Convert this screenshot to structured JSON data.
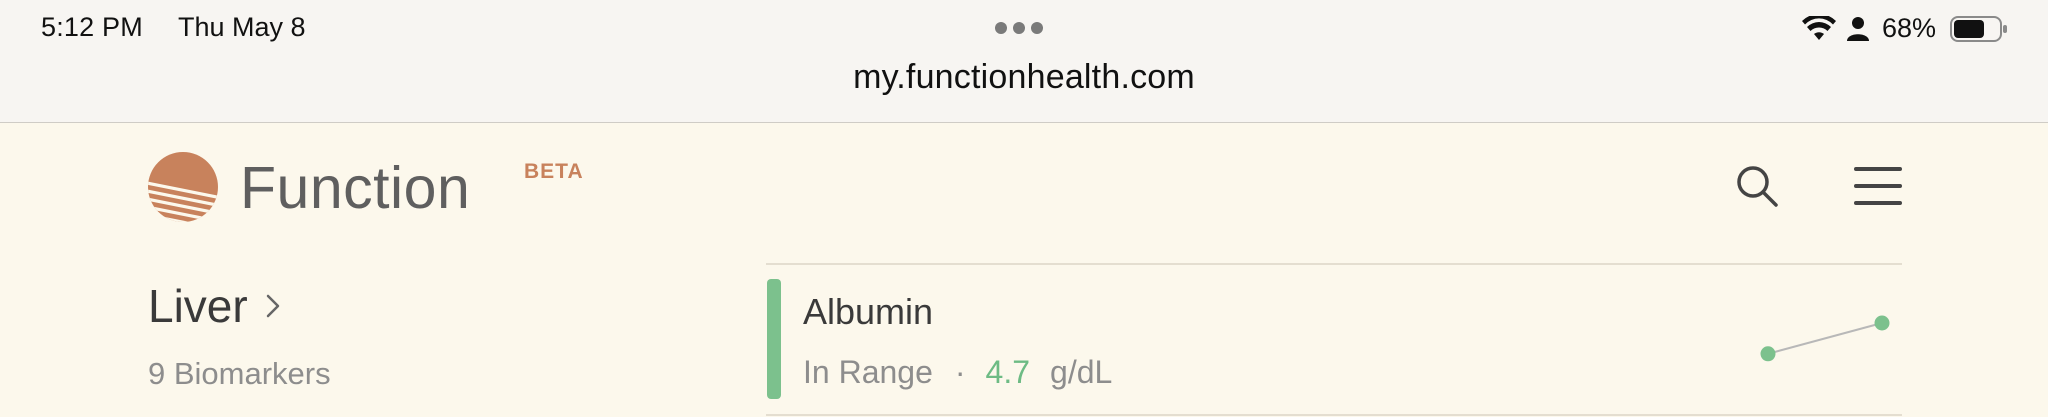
{
  "status_bar": {
    "time": "5:12 PM",
    "date": "Thu May 8",
    "battery": "68%"
  },
  "browser": {
    "url": "my.functionhealth.com"
  },
  "header": {
    "brand": "Function",
    "badge": "BETA"
  },
  "category": {
    "title": "Liver",
    "count": "9 Biomarkers"
  },
  "biomarker": {
    "name": "Albumin",
    "status": "In Range",
    "separator": "·",
    "value": "4.7",
    "unit": "g/dL",
    "trend": [
      0.3,
      1.0
    ]
  },
  "colors": {
    "background": "#fcf8ec",
    "brand_orange": "#c8825c",
    "in_range_green": "#7cc18d",
    "text_dark": "#3a3a3a",
    "text_muted": "#8d8d8d"
  },
  "icons": [
    "wifi-icon",
    "person-icon",
    "battery-icon",
    "function-logo-icon",
    "search-icon",
    "menu-icon",
    "chevron-right-icon"
  ]
}
